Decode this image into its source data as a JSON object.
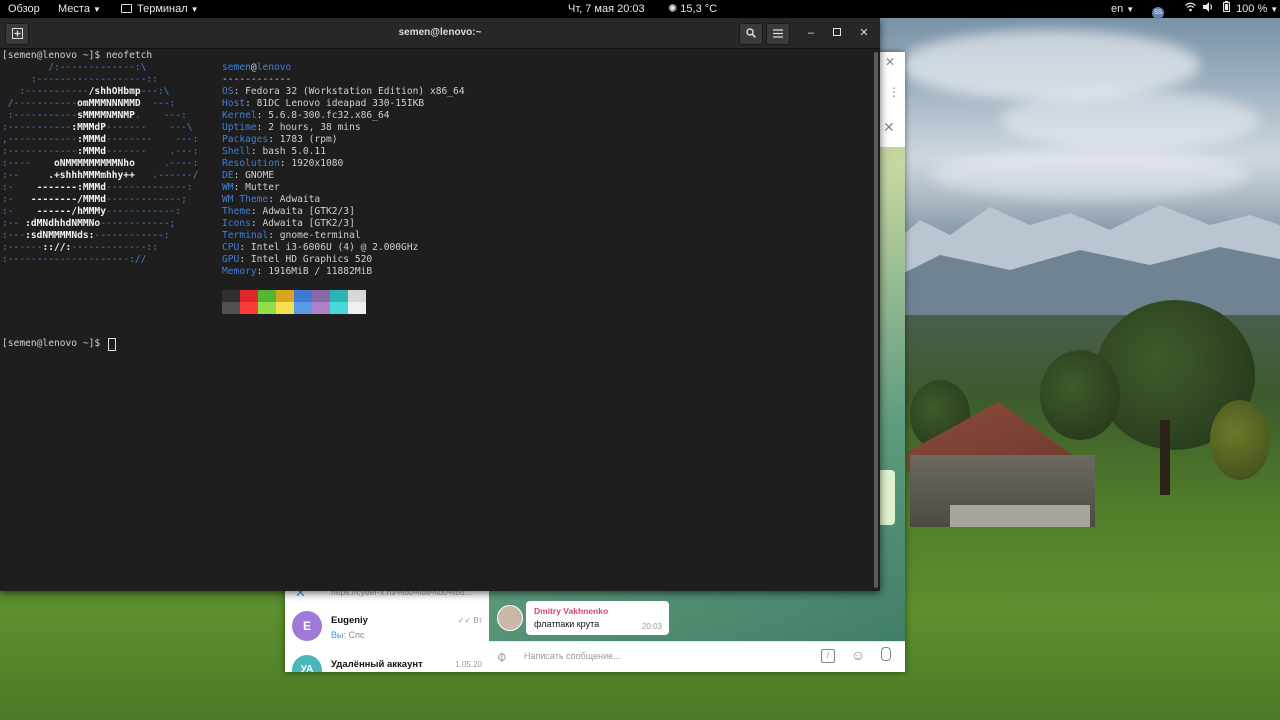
{
  "topbar": {
    "overview": "Обзор",
    "places": "Места",
    "app": "Терминал",
    "datetime": "Чт, 7 мая  20:03",
    "weather": "15,3 °C",
    "lang": "en",
    "avatar": "SS",
    "battery": "100 %"
  },
  "terminal": {
    "title": "semen@lenovo:~",
    "prompt1": "[semen@lenovo ~]$ neofetch",
    "prompt2": "[semen@lenovo ~]$ ",
    "logo": [
      [
        "        ",
        "/:-------------:\\",
        "",
        ""
      ],
      [
        "     ",
        ":-------------------::",
        "",
        ""
      ],
      [
        "   ",
        ":-----------",
        "/shhOHbmp",
        "---:\\"
      ],
      [
        " ",
        "/-----------",
        "omMMMNNNMMD",
        "  ---:"
      ],
      [
        " ",
        ":-----------",
        "sMMMMNMNMP",
        ".    ---:"
      ],
      [
        "",
        ":-----------",
        ":MMMdP",
        "-------    ---\\"
      ],
      [
        "",
        ",------------",
        ":MMMd",
        "--------    ---:"
      ],
      [
        "",
        ":------------",
        ":MMMd",
        "-------    .---:"
      ],
      [
        "",
        ":----    ",
        "oNMMMMMMMMMNho",
        "     .----:"
      ],
      [
        "",
        ":--     ",
        ".+shhhMMMmhhy++",
        "   .------/"
      ],
      [
        "",
        ":-    ",
        "-------:MMMd",
        "--------------:"
      ],
      [
        "",
        ":-   ",
        "--------/MMMd",
        "-------------;"
      ],
      [
        "",
        ":-    ",
        "------/hMMMy",
        "------------:"
      ],
      [
        "",
        ":-- ",
        ":dMNdhhdNMMNo",
        "------------;"
      ],
      [
        "",
        ":---",
        ":sdNMMMMNds:",
        "------------:"
      ],
      [
        "",
        ":------",
        ":://:",
        "-------------::"
      ],
      [
        "",
        ":---------------------://",
        "",
        ""
      ]
    ],
    "user": "semen",
    "at": "@",
    "host": "lenovo",
    "separator": "------------",
    "info": [
      {
        "key": "OS",
        "value": "Fedora 32 (Workstation Edition) x86_64"
      },
      {
        "key": "Host",
        "value": "81DC Lenovo ideapad 330-15IKB"
      },
      {
        "key": "Kernel",
        "value": "5.6.8-300.fc32.x86_64"
      },
      {
        "key": "Uptime",
        "value": "2 hours, 38 mins"
      },
      {
        "key": "Packages",
        "value": "1783 (rpm)"
      },
      {
        "key": "Shell",
        "value": "bash 5.0.11"
      },
      {
        "key": "Resolution",
        "value": "1920x1080"
      },
      {
        "key": "DE",
        "value": "GNOME"
      },
      {
        "key": "WM",
        "value": "Mutter"
      },
      {
        "key": "WM Theme",
        "value": "Adwaita"
      },
      {
        "key": "Theme",
        "value": "Adwaita [GTK2/3]"
      },
      {
        "key": "Icons",
        "value": "Adwaita [GTK2/3]"
      },
      {
        "key": "Terminal",
        "value": "gnome-terminal"
      },
      {
        "key": "CPU",
        "value": "Intel i3-6006U (4) @ 2.000GHz"
      },
      {
        "key": "GPU",
        "value": "Intel HD Graphics 520"
      },
      {
        "key": "Memory",
        "value": "1916MiB / 11882MiB"
      }
    ],
    "palette_dark": [
      "#303030",
      "#e0262d",
      "#54b52f",
      "#d9a51f",
      "#3d7ad1",
      "#8c68a6",
      "#2ab5b5",
      "#d8d8d8"
    ],
    "palette_light": [
      "#505050",
      "#ff3a3a",
      "#8fe04a",
      "#f4e04a",
      "#5b9ae8",
      "#b07fc8",
      "#4ad9d9",
      "#f0f0f0"
    ]
  },
  "telegram": {
    "link_preview": "https://cyber-x.ru/%d0%b8%d0%bd...",
    "chats": [
      {
        "initial": "E",
        "name": "Eugeniy",
        "preview_prefix": "Вы:",
        "preview": "Спс",
        "time": "Вт",
        "color": "#a07ad8"
      },
      {
        "initial": "УА",
        "name": "Удалённый аккаунт",
        "preview_prefix": "",
        "preview": "",
        "time": "1.05.20",
        "color": "#4ab8b8"
      }
    ],
    "message": {
      "author": "Dmitry Vakhnenko",
      "text": "флатпаки крута",
      "time": "20:03"
    },
    "input_placeholder": "Написать сообщение..."
  }
}
